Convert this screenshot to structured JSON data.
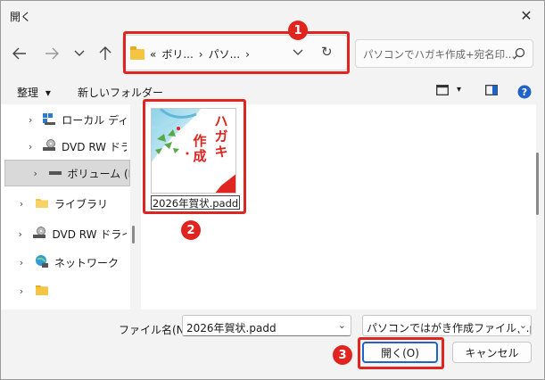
{
  "window": {
    "title": "開く",
    "close_glyph": "✕"
  },
  "address_bar": {
    "overflow": "«",
    "crumbs": [
      "ボリ...",
      "パソ..."
    ],
    "separator": "›",
    "dropdown_glyph": "⌄",
    "refresh_glyph": "↻"
  },
  "search": {
    "placeholder": "パソコンでハガキ作成+宛名印..."
  },
  "toolbar": {
    "organize": "整理",
    "dropdown_glyph": "▾",
    "new_folder": "新しいフォルダー"
  },
  "nav_pane": {
    "items": [
      {
        "label": "ローカル ディスク",
        "icon": "local-disk-icon",
        "chevron": "›",
        "selected": false
      },
      {
        "label": "DVD RW ドライブ",
        "icon": "dvd-drive-icon",
        "chevron": "›",
        "selected": false
      },
      {
        "label": "ボリューム (E:)",
        "icon": "volume-drive-icon",
        "chevron": "›",
        "selected": true
      },
      {
        "label": "ライブラリ",
        "icon": "library-folder-icon",
        "chevron": "›",
        "selected": false
      },
      {
        "label": "DVD RW ドライブ",
        "icon": "dvd-drive-icon",
        "chevron": "›",
        "selected": false
      },
      {
        "label": "ネットワーク",
        "icon": "network-icon",
        "chevron": "›",
        "selected": false
      },
      {
        "label": "",
        "icon": "folder-icon",
        "chevron": "›",
        "selected": false
      }
    ]
  },
  "file": {
    "name": "2026年賀状.padd",
    "thumbnail_text": [
      "ハ",
      "ガ",
      "キ",
      "作",
      "成"
    ]
  },
  "bottom": {
    "filename_label": "ファイル名(N):",
    "filename_value": "2026年賀状.padd",
    "filetype_value": "パソコンではがき作成ファイル(*.pad",
    "open_button": "開く(O)",
    "cancel_button": "キャンセル"
  },
  "callouts": [
    "1",
    "2",
    "3"
  ],
  "colors": {
    "highlight": "#e0241f",
    "primary_border": "#1f63c9",
    "thumb_text": "#e0241f"
  }
}
